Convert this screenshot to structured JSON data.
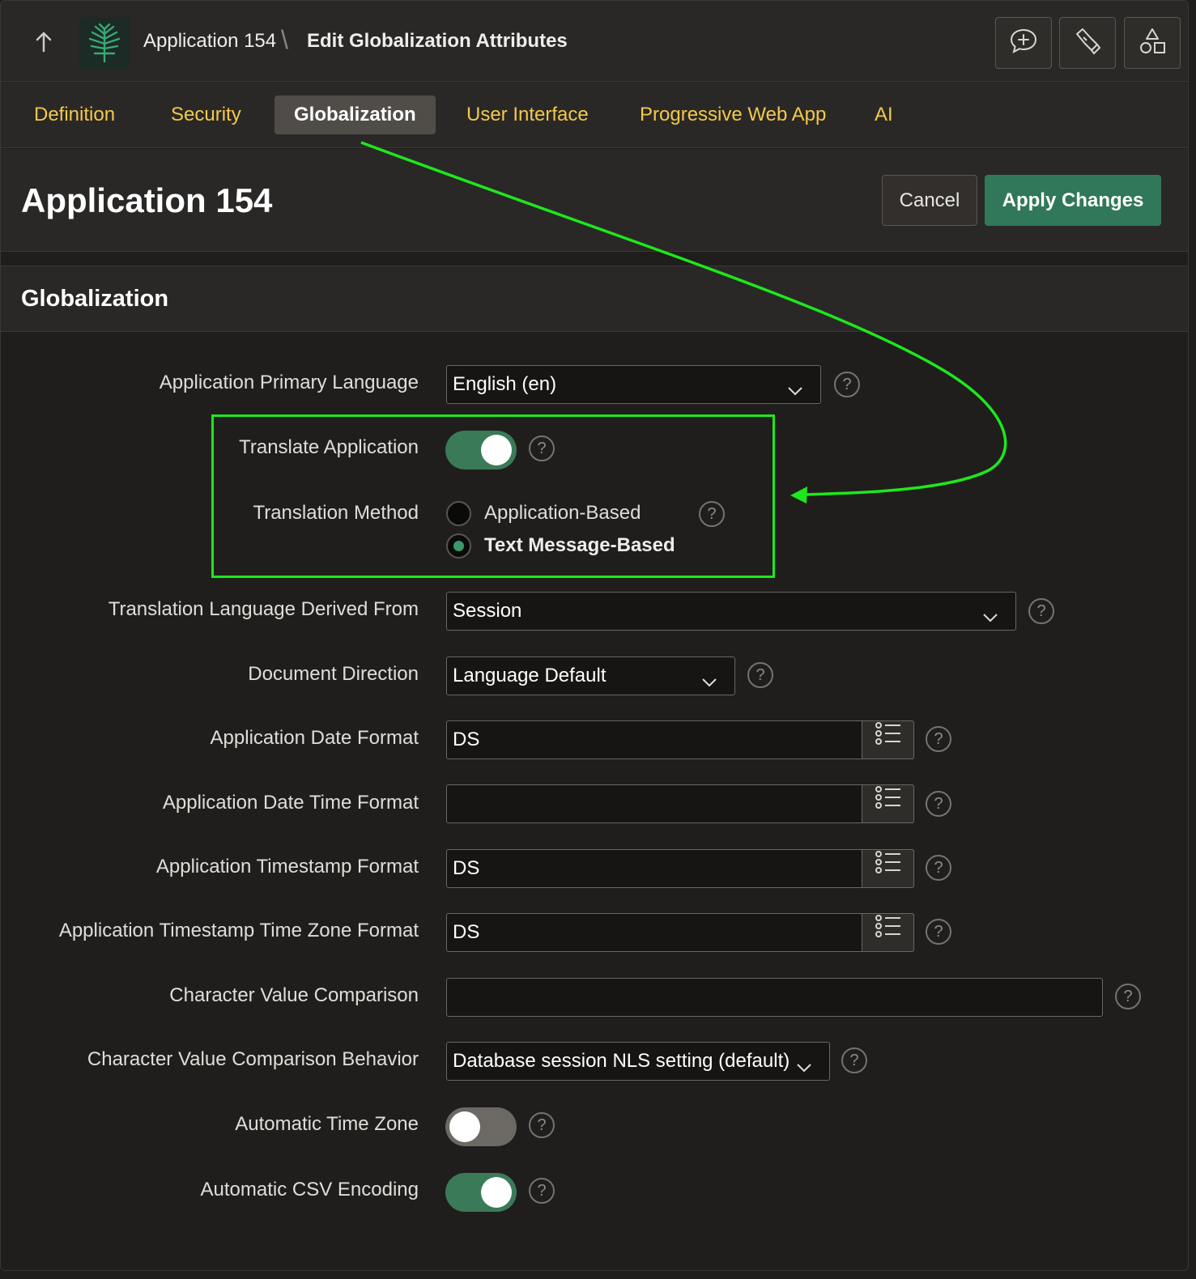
{
  "header": {
    "app_breadcrumb": "Application 154",
    "separator": "\\",
    "page_breadcrumb": "Edit Globalization Attributes"
  },
  "tabs": [
    {
      "label": "Definition"
    },
    {
      "label": "Security"
    },
    {
      "label": "Globalization"
    },
    {
      "label": "User Interface"
    },
    {
      "label": "Progressive Web App"
    },
    {
      "label": "AI"
    }
  ],
  "page": {
    "title": "Application 154",
    "cancel_label": "Cancel",
    "apply_label": "Apply Changes"
  },
  "region": {
    "title": "Globalization"
  },
  "form": {
    "primary_language": {
      "label": "Application Primary Language",
      "value": "English (en)"
    },
    "translate_application": {
      "label": "Translate Application",
      "on": true
    },
    "translation_method": {
      "label": "Translation Method",
      "options": [
        "Application-Based",
        "Text Message-Based"
      ],
      "selected": "Text Message-Based"
    },
    "language_derived_from": {
      "label": "Translation Language Derived From",
      "value": "Session"
    },
    "document_direction": {
      "label": "Document Direction",
      "value": "Language Default"
    },
    "date_format": {
      "label": "Application Date Format",
      "value": "DS"
    },
    "date_time_format": {
      "label": "Application Date Time Format",
      "value": ""
    },
    "timestamp_format": {
      "label": "Application Timestamp Format",
      "value": "DS"
    },
    "timestamp_tz_format": {
      "label": "Application Timestamp Time Zone Format",
      "value": "DS"
    },
    "char_value_comparison": {
      "label": "Character Value Comparison",
      "value": ""
    },
    "char_value_comparison_behavior": {
      "label": "Character Value Comparison Behavior",
      "value": "Database session NLS setting (default)"
    },
    "automatic_time_zone": {
      "label": "Automatic Time Zone",
      "on": false
    },
    "automatic_csv_encoding": {
      "label": "Automatic CSV Encoding",
      "on": true
    },
    "help_glyph": "?"
  },
  "colors": {
    "accent_tab": "#f2c94c",
    "apply_button": "#31785a",
    "toggle_on": "#3b7a58",
    "annotation": "#1de81d"
  },
  "icons": [
    "up-arrow-icon",
    "app-logo-icon",
    "chat-add-icon",
    "flashlight-icon",
    "shapes-icon",
    "chevron-down-icon",
    "list-icon",
    "help-icon"
  ]
}
